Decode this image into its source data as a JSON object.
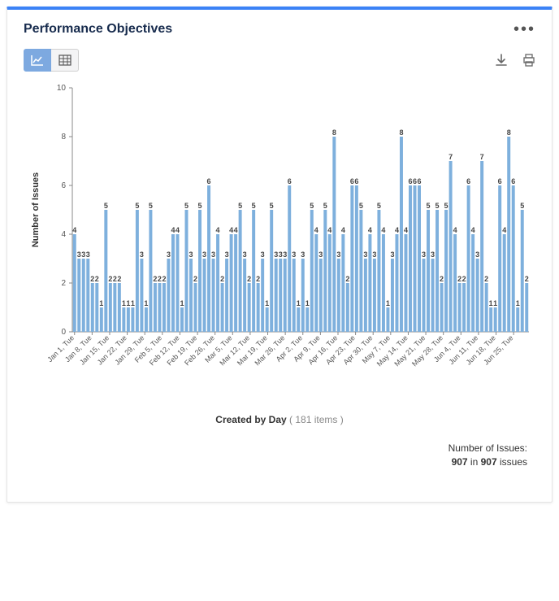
{
  "header": {
    "title": "Performance Objectives"
  },
  "toolbar": {
    "chart_view_label": "Chart view",
    "table_view_label": "Table view",
    "download_label": "Download",
    "print_label": "Print"
  },
  "yaxis": {
    "title": "Number of Issues",
    "ticks": [
      0,
      2,
      4,
      6,
      8,
      10
    ]
  },
  "xaxis": {
    "title": "Created by Day",
    "items_label": "( 181 items )"
  },
  "summary": {
    "line1": "Number of Issues:",
    "bold1": "907",
    "mid": " in ",
    "bold2": "907",
    "end": " issues"
  },
  "chart_data": {
    "type": "bar",
    "title": "Performance Objectives",
    "ylabel": "Number of Issues",
    "xlabel": "Created by Day",
    "ylim": [
      0,
      10
    ],
    "categories": [
      "Jan 1, Tue",
      "",
      "",
      "",
      "",
      "",
      "",
      "Jan 8, Tue",
      "",
      "",
      "",
      "",
      "",
      "",
      "Jan 15, Tue",
      "",
      "",
      "",
      "",
      "",
      "",
      "Jan 22, Tue",
      "",
      "",
      "",
      "",
      "",
      "",
      "Jan 29, Tue",
      "",
      "",
      "",
      "",
      "",
      "",
      "Feb 5, Tue",
      "",
      "",
      "",
      "",
      "",
      "",
      "Feb 12, Tue",
      "",
      "",
      "",
      "",
      "",
      "",
      "Feb 19, Tue",
      "",
      "",
      "",
      "",
      "",
      "",
      "Feb 26, Tue",
      "",
      "",
      "",
      "",
      "",
      "",
      "Mar 5, Tue",
      "",
      "",
      "",
      "",
      "",
      "",
      "Mar 12, Tue",
      "",
      "",
      "",
      "",
      "",
      "",
      "Mar 19, Tue",
      "",
      "",
      "",
      "",
      "",
      "",
      "Mar 26, Tue",
      "",
      "",
      "",
      "",
      "",
      "",
      "Apr 2, Tue",
      "",
      "",
      "",
      "",
      "",
      "",
      "Apr 9, Tue",
      "",
      "",
      "",
      "",
      "",
      "",
      "Apr 16, Tue",
      "",
      "",
      "",
      "",
      "",
      "",
      "Apr 23, Tue",
      "",
      "",
      "",
      "",
      "",
      "",
      "Apr 30, Tue",
      "",
      "",
      "",
      "",
      "",
      "",
      "May 7, Tue",
      "",
      "",
      "",
      "",
      "",
      "",
      "May 14, Tue",
      "",
      "",
      "",
      "",
      "",
      "",
      "May 21, Tue",
      "",
      "",
      "",
      "",
      "",
      "",
      "May 28, Tue",
      "",
      "",
      "",
      "",
      "",
      "",
      "Jun 4, Tue",
      "",
      "",
      "",
      "",
      "",
      "",
      "Jun 11, Tue",
      "",
      "",
      "",
      "",
      "",
      "",
      "Jun 18, Tue",
      "",
      "",
      "",
      "",
      "",
      "",
      "Jun 25, Tue",
      "",
      "",
      ""
    ],
    "x_ticks": [
      "Jan 1, Tue",
      "Jan 8, Tue",
      "Jan 15, Tue",
      "Jan 22, Tue",
      "Jan 29, Tue",
      "Feb 5, Tue",
      "Feb 12, Tue",
      "Feb 19, Tue",
      "Feb 26, Tue",
      "Mar 5, Tue",
      "Mar 12, Tue",
      "Mar 19, Tue",
      "Mar 26, Tue",
      "Apr 2, Tue",
      "Apr 9, Tue",
      "Apr 16, Tue",
      "Apr 23, Tue",
      "Apr 30, Tue",
      "May 7, Tue",
      "May 14, Tue",
      "May 21, Tue",
      "May 28, Tue",
      "Jun 4, Tue",
      "Jun 11, Tue",
      "Jun 18, Tue",
      "Jun 25, Tue"
    ],
    "values": [
      4,
      3,
      3,
      3,
      2,
      2,
      1,
      5,
      2,
      2,
      2,
      1,
      1,
      1,
      5,
      3,
      1,
      5,
      2,
      2,
      2,
      3,
      4,
      4,
      1,
      5,
      3,
      2,
      5,
      3,
      6,
      3,
      4,
      2,
      3,
      4,
      4,
      5,
      3,
      2,
      5,
      2,
      3,
      1,
      5,
      3,
      3,
      3,
      6,
      3,
      1,
      3,
      1,
      5,
      4,
      3,
      5,
      4,
      8,
      3,
      4,
      2,
      6,
      6,
      5,
      3,
      4,
      3,
      5,
      4,
      1,
      3,
      4,
      8,
      4,
      6,
      6,
      6,
      3,
      5,
      3,
      5,
      2,
      5,
      7,
      4,
      2,
      2,
      6,
      4,
      3,
      7,
      2,
      1,
      1,
      6,
      4,
      8,
      6,
      1,
      5,
      2
    ]
  }
}
